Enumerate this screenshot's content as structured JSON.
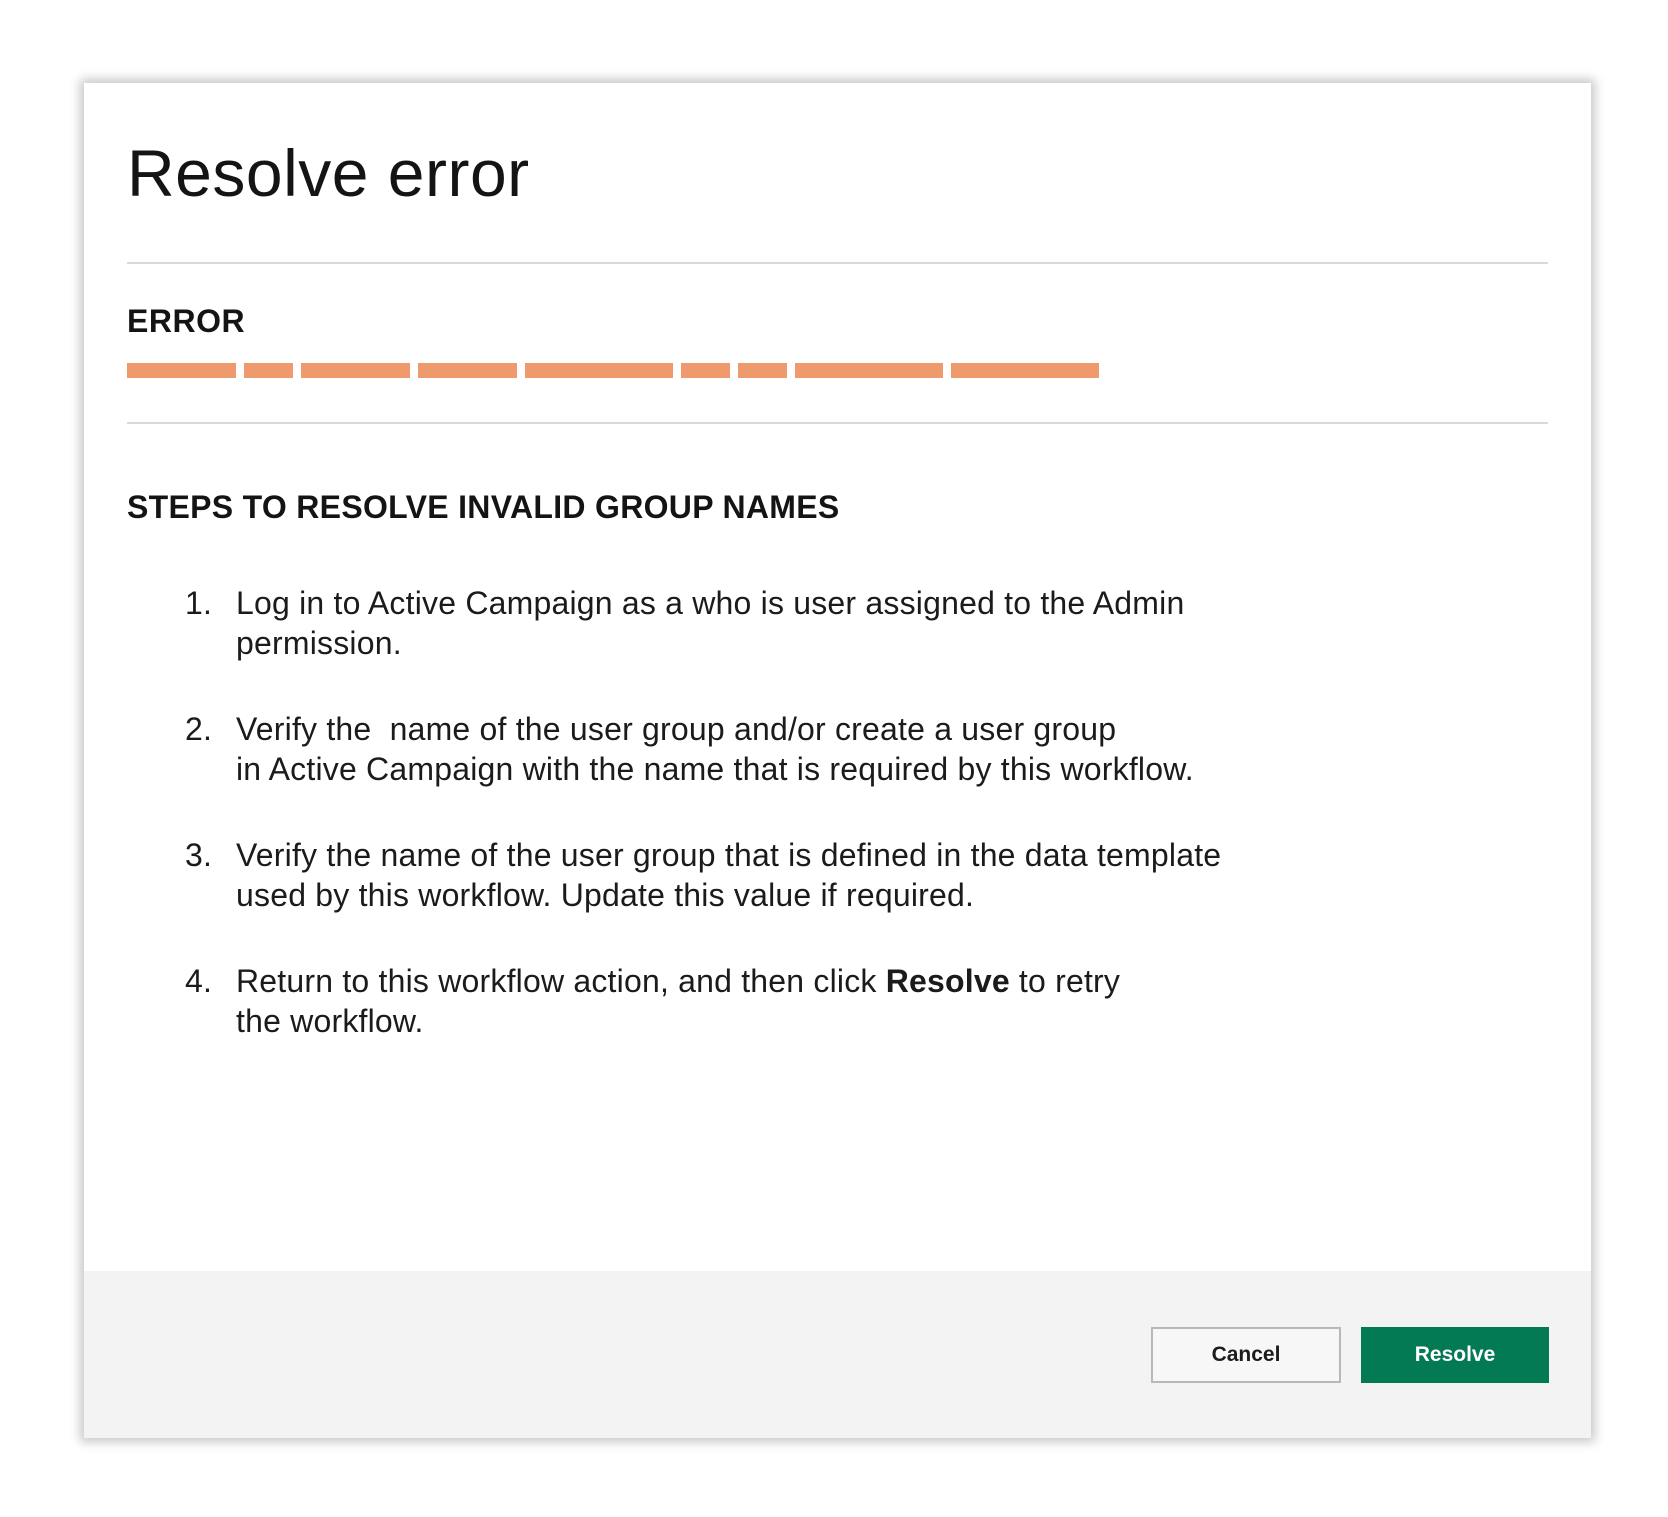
{
  "dialog": {
    "title": "Resolve error",
    "error_heading": "ERROR",
    "error_redacted_segments": 9,
    "steps_heading": "STEPS TO RESOLVE INVALID GROUP NAMES",
    "steps": [
      {
        "num": "1.",
        "lines": [
          "Log in to Active Campaign as a who is user assigned to the Admin",
          "permission."
        ]
      },
      {
        "num": "2.",
        "lines": [
          "Verify the  name of the user group and/or create a user group",
          "in Active Campaign with the name that is required by this workflow."
        ]
      },
      {
        "num": "3.",
        "lines": [
          "Verify the name of the user group that is defined in the data template",
          "used by this workflow. Update this value if required."
        ]
      },
      {
        "num": "4.",
        "line1_pre": "Return to this workflow action, and then click ",
        "line1_bold": "Resolve",
        "line1_post": " to retry",
        "line2": "the workflow."
      }
    ]
  },
  "footer": {
    "cancel_label": "Cancel",
    "resolve_label": "Resolve"
  },
  "colors": {
    "accent": "#047a54",
    "redaction": "#ee9a6c",
    "footer_bg": "#f2f3f2"
  }
}
